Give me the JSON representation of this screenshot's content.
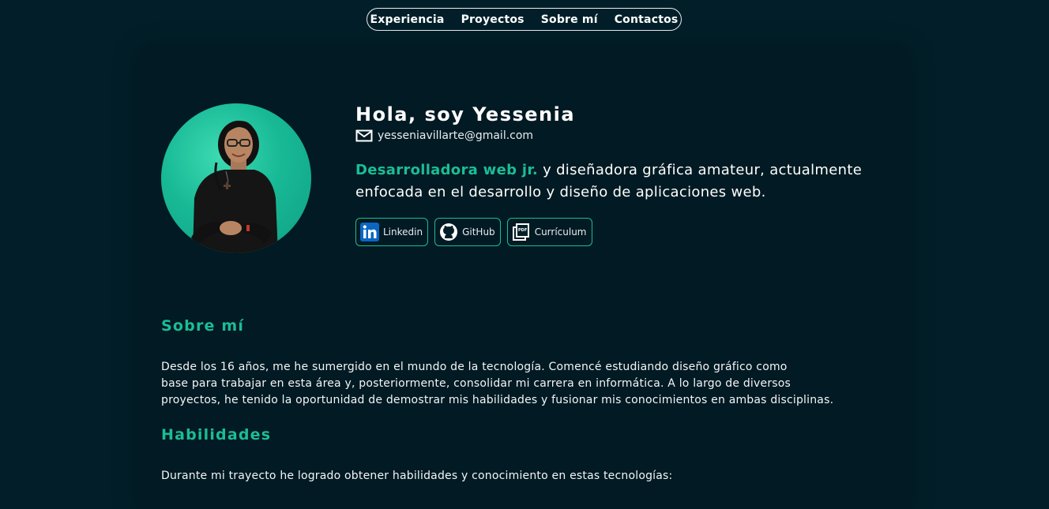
{
  "nav": {
    "items": [
      {
        "label": "Experiencia"
      },
      {
        "label": "Proyectos"
      },
      {
        "label": "Sobre mí"
      },
      {
        "label": "Contactos"
      }
    ]
  },
  "hero": {
    "title": "Hola, soy Yessenia",
    "email": "yesseniavillarte@gmail.com",
    "accent": "Desarrolladora web jr.",
    "description_line1": " y diseñadora gráfica amateur, actualmente",
    "description_line2": "enfocada en el desarrollo y diseño de aplicaciones web."
  },
  "social": {
    "linkedin": "Linkedin",
    "github": "GitHub",
    "cv": "Currículum"
  },
  "about": {
    "title": "Sobre mí",
    "line1": "Desde los 16 años, me he sumergido en el mundo de la tecnología. Comencé estudiando diseño gráfico como",
    "line2": "base para trabajar en esta área y, posteriormente, consolidar mi carrera en informática. A lo largo de diversos",
    "line3": "proyectos, he tenido la oportunidad de demostrar mis habilidades y fusionar mis conocimientos en ambas disciplinas."
  },
  "skills": {
    "title": "Habilidades",
    "intro": "Durante mi trayecto he logrado obtener habilidades y conocimiento en estas tecnologías:"
  },
  "colors": {
    "background": "#021f29",
    "accent": "#1bbd95",
    "text": "#ffffff"
  },
  "icons": {
    "email": "mail-icon",
    "linkedin": "linkedin-icon",
    "github": "github-icon",
    "cv": "pdf-icon"
  }
}
